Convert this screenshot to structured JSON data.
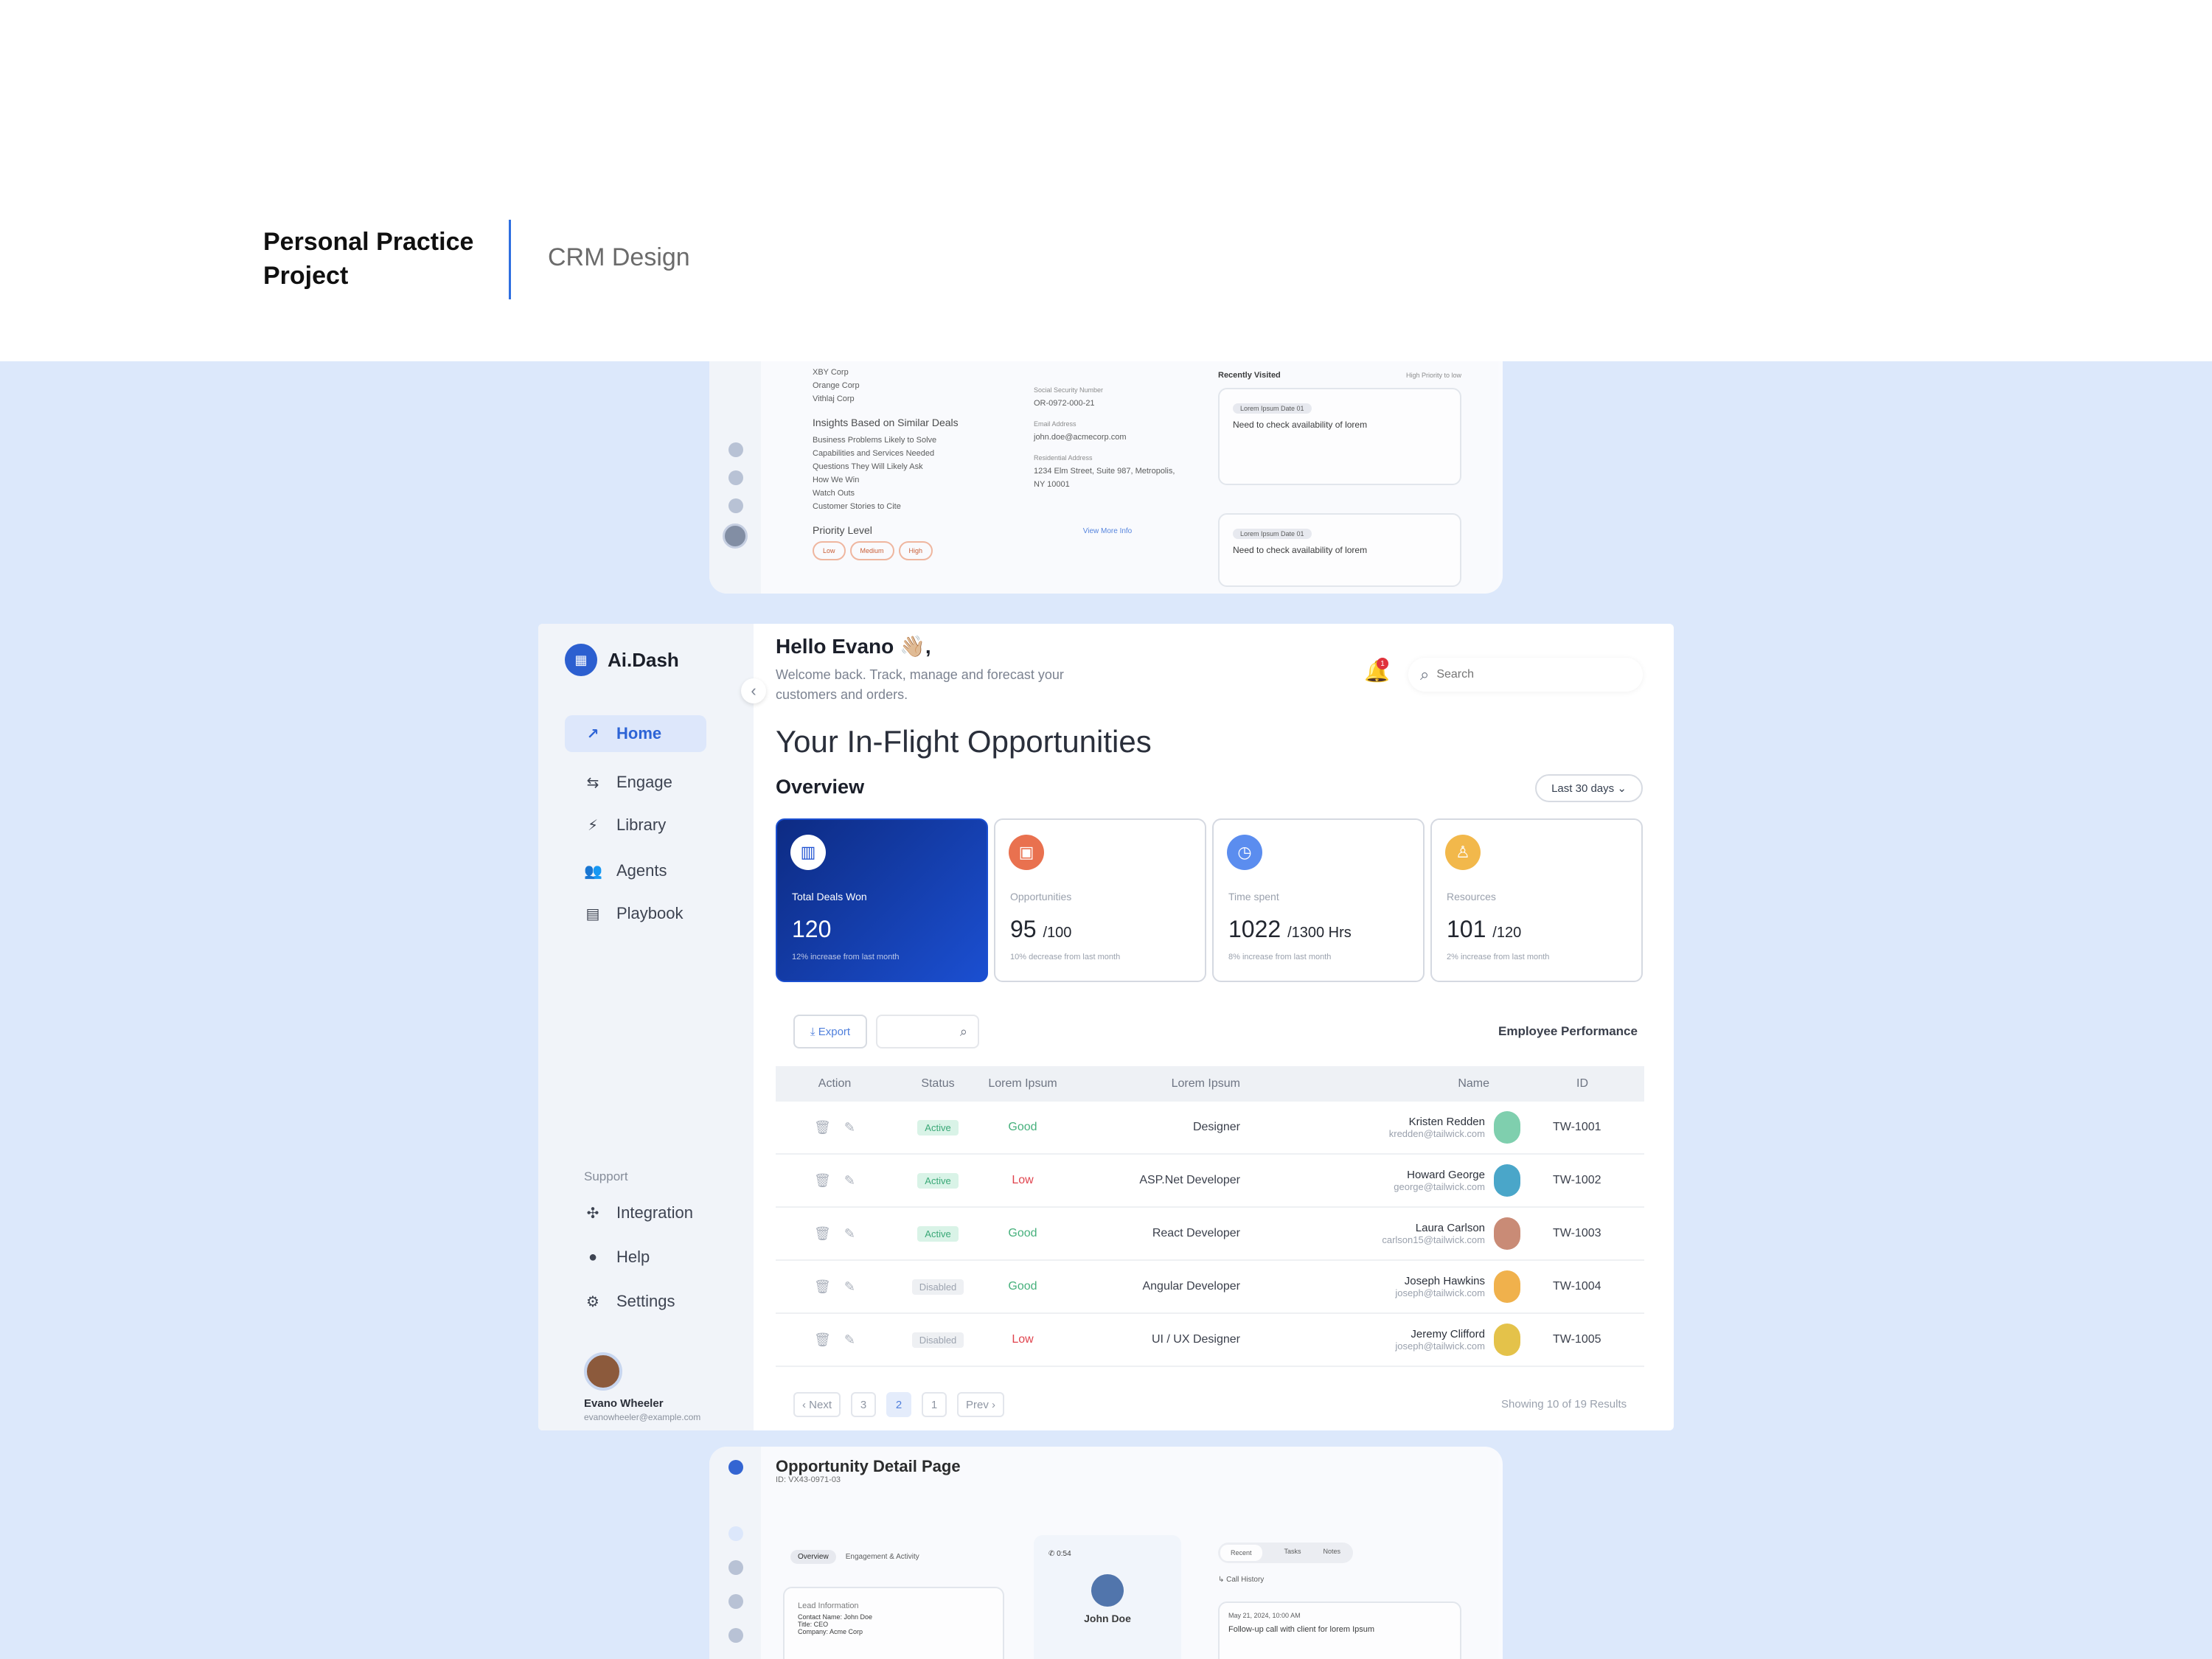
{
  "header": {
    "project_title": "Personal Practice Project",
    "project_subtitle": "CRM Design"
  },
  "top_preview": {
    "list_items": [
      "XBY Corp",
      "Orange Corp",
      "Vithlaj Corp"
    ],
    "insights_heading": "Insights Based on Similar Deals",
    "insights": [
      "Business Problems Likely to Solve",
      "Capabilities and Services Needed",
      "Questions They Will Likely Ask",
      "How We Win",
      "Watch Outs",
      "Customer Stories to Cite"
    ],
    "priority_heading": "Priority Level",
    "priority_options": [
      "Low",
      "Medium",
      "High"
    ],
    "ssn_label": "Social Security Number",
    "ssn_value": "OR-0972-000-21",
    "email_label": "Email Address",
    "email_value": "john.doe@acmecorp.com",
    "address_label": "Residential Address",
    "address_value": "1234 Elm Street, Suite 987, Metropolis, NY 10001",
    "view_more": "View More Info",
    "recently_visited": "Recently Visited",
    "sort_label": "High Priority to low",
    "note_tag_1": "Lorem Ipsum Date 01",
    "note_tag_2": "Lorem Ipsum Date 01",
    "note_text": "Need to check availability of lorem"
  },
  "sidebar": {
    "logo": "Ai.Dash",
    "items": [
      {
        "label": "Home",
        "icon": "trend-icon"
      },
      {
        "label": "Engage",
        "icon": "sliders-icon"
      },
      {
        "label": "Library",
        "icon": "bolt-icon"
      },
      {
        "label": "Agents",
        "icon": "users-icon"
      },
      {
        "label": "Playbook",
        "icon": "book-icon"
      }
    ],
    "support_label": "Support",
    "support_items": [
      {
        "label": "Integration",
        "icon": "puzzle-icon"
      },
      {
        "label": "Help",
        "icon": "bulb-icon"
      },
      {
        "label": "Settings",
        "icon": "gear-icon"
      }
    ],
    "user_name": "Evano Wheeler",
    "user_email": "evanowheeler@example.com"
  },
  "topbar": {
    "greeting": "Hello Evano 👋🏼,",
    "welcome": "Welcome back. Track, manage and forecast your customers and orders.",
    "notification_count": "1",
    "search_placeholder": "Search"
  },
  "main": {
    "page_title": "Your In-Flight Opportunities",
    "overview_title": "Overview",
    "range": "Last 30 days ⌄",
    "cards": [
      {
        "label": "Total Deals Won",
        "value": "120",
        "suffix": "",
        "note": "12% increase from last month",
        "color": "#1b4fd1"
      },
      {
        "label": "Opportunities",
        "value": "95",
        "suffix": "/100",
        "note": "10% decrease from last month",
        "color": "#e9714f"
      },
      {
        "label": "Time spent",
        "value": "1022",
        "suffix": "/1300 Hrs",
        "note": "8% increase from last month",
        "color": "#5b8def"
      },
      {
        "label": "Resources",
        "value": "101",
        "suffix": "/120",
        "note": "2% increase from last month",
        "color": "#f2b84b"
      }
    ],
    "export_label": "⤓ Export",
    "employee_performance": "Employee Performance",
    "table_headers": [
      "Action",
      "Status",
      "Lorem Ipsum",
      "Lorem Ipsum",
      "Name",
      "ID"
    ],
    "rows": [
      {
        "status": "Active",
        "l1": "Good",
        "l2": "Designer",
        "name": "Kristen Redden",
        "email": "kredden@tailwick.com",
        "id": "TW-1001"
      },
      {
        "status": "Active",
        "l1": "Low",
        "l2": "ASP.Net Developer",
        "name": "Howard George",
        "email": "george@tailwick.com",
        "id": "TW-1002"
      },
      {
        "status": "Active",
        "l1": "Good",
        "l2": "React Developer",
        "name": "Laura Carlson",
        "email": "carlson15@tailwick.com",
        "id": "TW-1003"
      },
      {
        "status": "Disabled",
        "l1": "Good",
        "l2": "Angular Developer",
        "name": "Joseph Hawkins",
        "email": "joseph@tailwick.com",
        "id": "TW-1004"
      },
      {
        "status": "Disabled",
        "l1": "Low",
        "l2": "UI / UX Designer",
        "name": "Jeremy Clifford",
        "email": "joseph@tailwick.com",
        "id": "TW-1005"
      }
    ],
    "pagination": [
      "‹ Next",
      "3",
      "2",
      "1",
      "Prev ›"
    ],
    "showing": "Showing 10 of 19 Results"
  },
  "bottom_preview": {
    "title": "Opportunity Detail Page",
    "id_line": "ID: VX43-0971-03",
    "tabs": [
      "Overview",
      "Engagement & Activity"
    ],
    "lead_heading": "Lead Information",
    "lead_items": [
      "Contact Name: John Doe",
      "Title: CEO",
      "Company: Acme Corp"
    ],
    "call_label": "0:54",
    "contact_name": "John Doe",
    "segments": [
      "Recent",
      "Tasks",
      "Notes"
    ],
    "call_history": "Call History",
    "call_date": "May 21, 2024, 10:00 AM",
    "call_note": "Follow-up call with client for lorem Ipsum"
  }
}
